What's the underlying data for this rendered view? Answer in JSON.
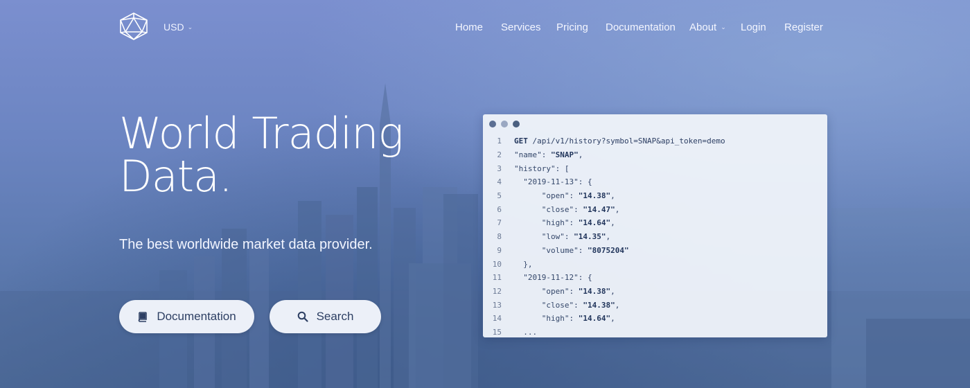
{
  "header": {
    "currency": "USD",
    "nav": [
      {
        "label": "Home"
      },
      {
        "label": "Services"
      },
      {
        "label": "Pricing"
      },
      {
        "label": "Documentation"
      },
      {
        "label": "About"
      },
      {
        "label": "Login"
      },
      {
        "label": "Register"
      }
    ]
  },
  "hero": {
    "title_line1": "World Trading",
    "title_line2": "Data.",
    "subtitle": "The best worldwide market data provider.",
    "buttons": {
      "documentation": "Documentation",
      "search": "Search"
    }
  },
  "code_window": {
    "lines": [
      {
        "n": "1",
        "method": "GET",
        "text": " /api/v1/history?symbol=SNAP&api_token=demo"
      },
      {
        "n": "2",
        "key": "\"name\"",
        "sep": ": ",
        "val": "\"SNAP\"",
        "tail": ","
      },
      {
        "n": "3",
        "key": "\"history\"",
        "sep": ": ",
        "val": "",
        "tail": "["
      },
      {
        "n": "4",
        "key": "  \"2019-11-13\"",
        "sep": ": ",
        "val": "",
        "tail": "{"
      },
      {
        "n": "5",
        "key": "      \"open\"",
        "sep": ": ",
        "val": "\"14.38\"",
        "tail": ","
      },
      {
        "n": "6",
        "key": "      \"close\"",
        "sep": ": ",
        "val": "\"14.47\"",
        "tail": ","
      },
      {
        "n": "7",
        "key": "      \"high\"",
        "sep": ": ",
        "val": "\"14.64\"",
        "tail": ","
      },
      {
        "n": "8",
        "key": "      \"low\"",
        "sep": ": ",
        "val": "\"14.35\"",
        "tail": ","
      },
      {
        "n": "9",
        "key": "      \"volume\"",
        "sep": ": ",
        "val": "\"8075204\"",
        "tail": ""
      },
      {
        "n": "10",
        "key": "  },",
        "sep": "",
        "val": "",
        "tail": ""
      },
      {
        "n": "11",
        "key": "  \"2019-11-12\"",
        "sep": ": ",
        "val": "",
        "tail": "{"
      },
      {
        "n": "12",
        "key": "      \"open\"",
        "sep": ": ",
        "val": "\"14.38\"",
        "tail": ","
      },
      {
        "n": "13",
        "key": "      \"close\"",
        "sep": ": ",
        "val": "\"14.38\"",
        "tail": ","
      },
      {
        "n": "14",
        "key": "      \"high\"",
        "sep": ": ",
        "val": "\"14.64\"",
        "tail": ","
      },
      {
        "n": "15",
        "key": "  ...",
        "sep": "",
        "val": "",
        "tail": ""
      }
    ]
  },
  "colors": {
    "background": "#6f86c4",
    "button_bg": "#ecf0f8",
    "button_text": "#2d3f63",
    "code_bg": "#eef2f9"
  },
  "icons": {
    "logo": "icosahedron-logo-icon",
    "currency_dropdown": "chevron-down-icon",
    "about_dropdown": "chevron-down-icon",
    "documentation_button": "book-icon",
    "search_button": "search-icon"
  }
}
